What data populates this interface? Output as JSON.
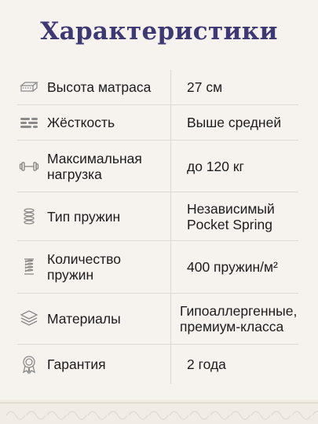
{
  "title": "Характеристики",
  "rows": [
    {
      "icon": "mattress-icon",
      "label": "Высота матраса",
      "value": "27 см"
    },
    {
      "icon": "firmness-bars-icon",
      "label": "Жёсткость",
      "value": "Выше средней"
    },
    {
      "icon": "dumbbell-icon",
      "label": "Максимальная нагрузка",
      "value": "до 120 кг"
    },
    {
      "icon": "spring-icon",
      "label": "Тип пружин",
      "value": "Независимый Pocket Spring"
    },
    {
      "icon": "spring-coil-icon",
      "label": "Количество пружин",
      "value": "400 пружин/м²"
    },
    {
      "icon": "layers-icon",
      "label": "Материалы",
      "value": "Гипоаллергенные, премиум-класса"
    },
    {
      "icon": "warranty-badge-icon",
      "label": "Гарантия",
      "value": "2 года"
    }
  ],
  "colors": {
    "title": "#3e3873",
    "background": "#f6f3ef",
    "divider": "#ddd8d2",
    "icon": "#8a8a8a",
    "ornament": "#e4ddd4"
  }
}
